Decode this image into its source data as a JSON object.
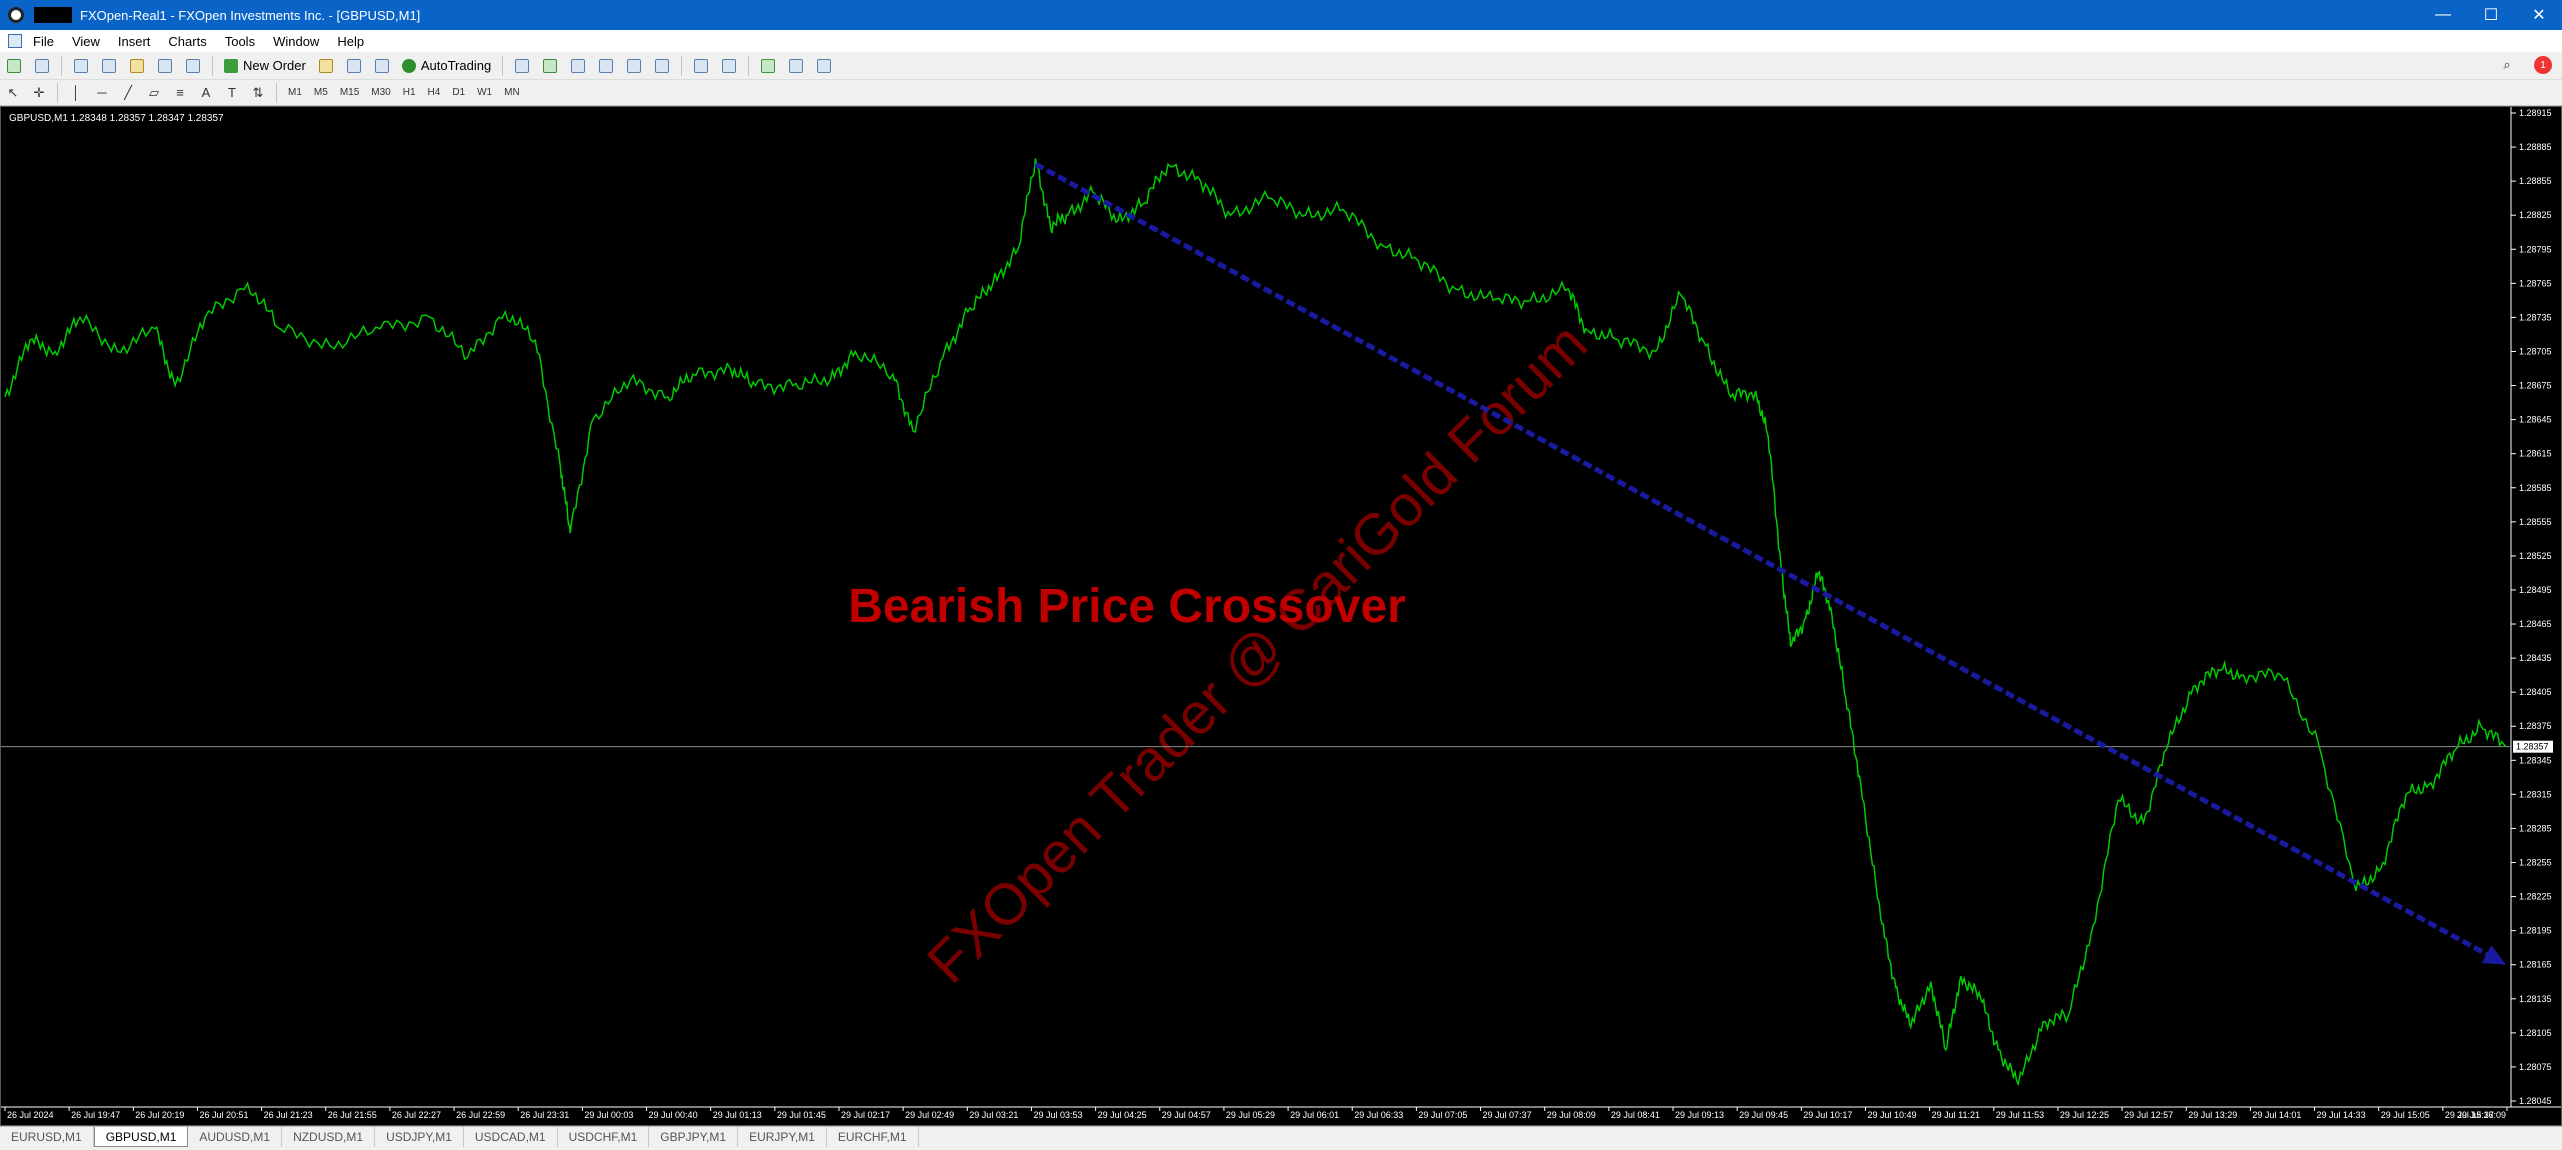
{
  "window": {
    "title": "FXOpen-Real1 - FXOpen Investments Inc. - [GBPUSD,M1]",
    "controls": {
      "minimize": "—",
      "maximize": "☐",
      "close": "✕"
    }
  },
  "menu": [
    "File",
    "View",
    "Insert",
    "Charts",
    "Tools",
    "Window",
    "Help"
  ],
  "toolbar": {
    "new_order": "New Order",
    "autotrading": "AutoTrading",
    "notification_count": "1",
    "timeframes": [
      "M1",
      "M5",
      "M15",
      "M30",
      "H1",
      "H4",
      "D1",
      "W1",
      "MN"
    ]
  },
  "chart": {
    "header": "GBPUSD,M1  1.28348 1.28357 1.28347 1.28357",
    "current_price": "1.28357",
    "annotation": "Bearish Price Crossover",
    "watermark": "FXOpen Trader @ CariGold Forum",
    "colors": {
      "background": "#000000",
      "price_line": "#00cc00",
      "arrow": "#1a1aa0",
      "annotation": "#c00000",
      "watermark": "#7a0000"
    }
  },
  "chart_data": {
    "type": "line",
    "title": "GBPUSD,M1",
    "series": [
      {
        "name": "GBPUSD",
        "points": [
          [
            0,
            1.28665
          ],
          [
            0.01,
            1.28715
          ],
          [
            0.02,
            1.28705
          ],
          [
            0.03,
            1.28735
          ],
          [
            0.045,
            1.28705
          ],
          [
            0.06,
            1.28725
          ],
          [
            0.068,
            1.28675
          ],
          [
            0.08,
            1.28735
          ],
          [
            0.097,
            1.28765
          ],
          [
            0.11,
            1.28725
          ],
          [
            0.13,
            1.2871
          ],
          [
            0.15,
            1.28725
          ],
          [
            0.17,
            1.28735
          ],
          [
            0.185,
            1.287
          ],
          [
            0.2,
            1.2874
          ],
          [
            0.212,
            1.28715
          ],
          [
            0.222,
            1.28605
          ],
          [
            0.226,
            1.28545
          ],
          [
            0.235,
            1.28645
          ],
          [
            0.25,
            1.2868
          ],
          [
            0.265,
            1.28665
          ],
          [
            0.275,
            1.28685
          ],
          [
            0.29,
            1.2869
          ],
          [
            0.3,
            1.28675
          ],
          [
            0.315,
            1.28675
          ],
          [
            0.33,
            1.2868
          ],
          [
            0.34,
            1.28705
          ],
          [
            0.355,
            1.28685
          ],
          [
            0.363,
            1.28635
          ],
          [
            0.375,
            1.287
          ],
          [
            0.385,
            1.2874
          ],
          [
            0.395,
            1.28765
          ],
          [
            0.405,
            1.28795
          ],
          [
            0.412,
            1.28875
          ],
          [
            0.418,
            1.28815
          ],
          [
            0.425,
            1.28825
          ],
          [
            0.435,
            1.28845
          ],
          [
            0.445,
            1.2882
          ],
          [
            0.455,
            1.28835
          ],
          [
            0.465,
            1.2887
          ],
          [
            0.478,
            1.28855
          ],
          [
            0.49,
            1.28825
          ],
          [
            0.505,
            1.2884
          ],
          [
            0.52,
            1.28825
          ],
          [
            0.535,
            1.2883
          ],
          [
            0.55,
            1.288
          ],
          [
            0.565,
            1.28785
          ],
          [
            0.58,
            1.2876
          ],
          [
            0.595,
            1.2875
          ],
          [
            0.61,
            1.2875
          ],
          [
            0.625,
            1.2876
          ],
          [
            0.632,
            1.28725
          ],
          [
            0.645,
            1.28715
          ],
          [
            0.66,
            1.28705
          ],
          [
            0.67,
            1.28755
          ],
          [
            0.68,
            1.2871
          ],
          [
            0.69,
            1.28665
          ],
          [
            0.7,
            1.2867
          ],
          [
            0.705,
            1.2863
          ],
          [
            0.71,
            1.2852
          ],
          [
            0.714,
            1.28445
          ],
          [
            0.72,
            1.2847
          ],
          [
            0.725,
            1.2851
          ],
          [
            0.73,
            1.2848
          ],
          [
            0.736,
            1.284
          ],
          [
            0.742,
            1.28325
          ],
          [
            0.75,
            1.28205
          ],
          [
            0.756,
            1.28145
          ],
          [
            0.762,
            1.2811
          ],
          [
            0.77,
            1.2815
          ],
          [
            0.776,
            1.2809
          ],
          [
            0.782,
            1.28155
          ],
          [
            0.79,
            1.28135
          ],
          [
            0.797,
            1.2809
          ],
          [
            0.805,
            1.2806
          ],
          [
            0.815,
            1.28115
          ],
          [
            0.825,
            1.2812
          ],
          [
            0.835,
            1.282
          ],
          [
            0.845,
            1.2831
          ],
          [
            0.855,
            1.2829
          ],
          [
            0.865,
            1.2836
          ],
          [
            0.875,
            1.2841
          ],
          [
            0.885,
            1.28425
          ],
          [
            0.895,
            1.2842
          ],
          [
            0.91,
            1.2842
          ],
          [
            0.925,
            1.2836
          ],
          [
            0.94,
            1.2823
          ],
          [
            0.95,
            1.2825
          ],
          [
            0.96,
            1.28315
          ],
          [
            0.97,
            1.28325
          ],
          [
            0.98,
            1.28355
          ],
          [
            0.99,
            1.28375
          ],
          [
            1.0,
            1.28357
          ]
        ]
      }
    ],
    "x_labels": [
      "26 Jul 2024",
      "26 Jul 19:47",
      "26 Jul 20:19",
      "26 Jul 20:51",
      "26 Jul 21:23",
      "26 Jul 21:55",
      "26 Jul 22:27",
      "26 Jul 22:59",
      "26 Jul 23:31",
      "29 Jul 00:03",
      "29 Jul 00:40",
      "29 Jul 01:13",
      "29 Jul 01:45",
      "29 Jul 02:17",
      "29 Jul 02:49",
      "29 Jul 03:21",
      "29 Jul 03:53",
      "29 Jul 04:25",
      "29 Jul 04:57",
      "29 Jul 05:29",
      "29 Jul 06:01",
      "29 Jul 06:33",
      "29 Jul 07:05",
      "29 Jul 07:37",
      "29 Jul 08:09",
      "29 Jul 08:41",
      "29 Jul 09:13",
      "29 Jul 09:45",
      "29 Jul 10:17",
      "29 Jul 10:49",
      "29 Jul 11:21",
      "29 Jul 11:53",
      "29 Jul 12:25",
      "29 Jul 12:57",
      "29 Jul 13:29",
      "29 Jul 14:01",
      "29 Jul 14:33",
      "29 Jul 15:05",
      "29 Jul 15:37",
      "29 Jul 16:09"
    ],
    "y_labels": [
      "1.28915",
      "1.28885",
      "1.28855",
      "1.28825",
      "1.28795",
      "1.28765",
      "1.28735",
      "1.28705",
      "1.28675",
      "1.28645",
      "1.28615",
      "1.28585",
      "1.28555",
      "1.28525",
      "1.28495",
      "1.28465",
      "1.28435",
      "1.28405",
      "1.28375",
      "1.28345",
      "1.28315",
      "1.28285",
      "1.28255",
      "1.28225",
      "1.28195",
      "1.28165",
      "1.28135",
      "1.28105",
      "1.28075",
      "1.28045"
    ],
    "ylim": [
      1.28045,
      1.28915
    ],
    "trend_arrow": {
      "from": [
        0.412,
        1.2887
      ],
      "to": [
        1.0,
        1.28165
      ]
    },
    "current_price_line": 1.28357,
    "grid": false
  },
  "tabs": [
    {
      "label": "EURUSD,M1",
      "active": false
    },
    {
      "label": "GBPUSD,M1",
      "active": true
    },
    {
      "label": "AUDUSD,M1",
      "active": false
    },
    {
      "label": "NZDUSD,M1",
      "active": false
    },
    {
      "label": "USDJPY,M1",
      "active": false
    },
    {
      "label": "USDCAD,M1",
      "active": false
    },
    {
      "label": "USDCHF,M1",
      "active": false
    },
    {
      "label": "GBPJPY,M1",
      "active": false
    },
    {
      "label": "EURJPY,M1",
      "active": false
    },
    {
      "label": "EURCHF,M1",
      "active": false
    }
  ]
}
